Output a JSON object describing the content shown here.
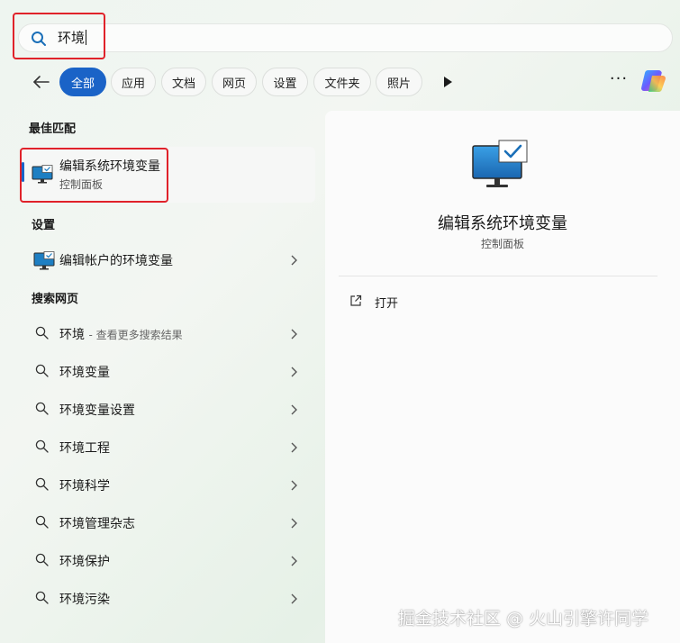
{
  "search": {
    "query": "环境"
  },
  "filters": {
    "tabs": [
      {
        "label": "全部",
        "active": true
      },
      {
        "label": "应用"
      },
      {
        "label": "文档"
      },
      {
        "label": "网页"
      },
      {
        "label": "设置"
      },
      {
        "label": "文件夹"
      },
      {
        "label": "照片"
      }
    ],
    "more_label": "···"
  },
  "best_match": {
    "heading": "最佳匹配",
    "title": "编辑系统环境变量",
    "subtitle": "控制面板"
  },
  "settings": {
    "heading": "设置",
    "items": [
      {
        "label": "编辑帐户的环境变量"
      }
    ]
  },
  "web": {
    "heading": "搜索网页",
    "first": {
      "label": "环境",
      "hint": "- 查看更多搜索结果"
    },
    "items": [
      {
        "label": "环境变量"
      },
      {
        "label": "环境变量设置"
      },
      {
        "label": "环境工程"
      },
      {
        "label": "环境科学"
      },
      {
        "label": "环境管理杂志"
      },
      {
        "label": "环境保护"
      },
      {
        "label": "环境污染"
      }
    ]
  },
  "detail": {
    "title": "编辑系统环境变量",
    "subtitle": "控制面板",
    "actions": [
      {
        "label": "打开"
      }
    ]
  },
  "watermark": "掘金技术社区 @ 火山引擎许同学",
  "colors": {
    "accent": "#1a63c7",
    "highlight_box": "#e0222a"
  }
}
